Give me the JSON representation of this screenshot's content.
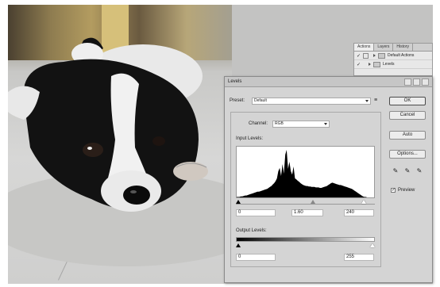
{
  "panels": {
    "tabs": [
      "Actions",
      "Layers",
      "History"
    ],
    "rows": [
      {
        "label": "Default Actions"
      },
      {
        "label": "Levels"
      }
    ]
  },
  "levels": {
    "title": "Levels",
    "preset_label": "Preset:",
    "preset_value": "Default",
    "channel_label": "Channel:",
    "channel_value": "RGB",
    "input_levels_label": "Input Levels:",
    "input_black": "0",
    "input_gamma": "1.60",
    "input_white": "240",
    "output_levels_label": "Output Levels:",
    "output_black": "0",
    "output_white": "255",
    "buttons": {
      "ok": "OK",
      "cancel": "Cancel",
      "auto": "Auto",
      "options": "Options..."
    },
    "preview_label": "Preview",
    "preview_checked": true
  },
  "histogram": [
    1,
    1,
    1,
    2,
    2,
    3,
    4,
    4,
    5,
    6,
    7,
    8,
    9,
    10,
    11,
    12,
    12,
    13,
    14,
    15,
    16,
    17,
    18,
    20,
    22,
    24,
    27,
    30,
    34,
    40,
    55,
    62,
    45,
    70,
    50,
    90,
    100,
    60,
    75,
    55,
    48,
    65,
    40,
    38,
    35,
    33,
    30,
    28,
    26,
    25,
    24,
    24,
    23,
    23,
    22,
    22,
    22,
    21,
    21,
    21,
    20,
    20,
    21,
    22,
    23,
    24,
    26,
    28,
    30,
    31,
    30,
    29,
    28,
    27,
    26,
    26,
    25,
    24,
    23,
    22,
    21,
    20,
    19,
    18,
    16,
    14,
    12,
    10,
    8,
    6,
    4,
    2,
    1,
    1,
    0,
    0,
    0,
    0,
    0,
    0
  ]
}
